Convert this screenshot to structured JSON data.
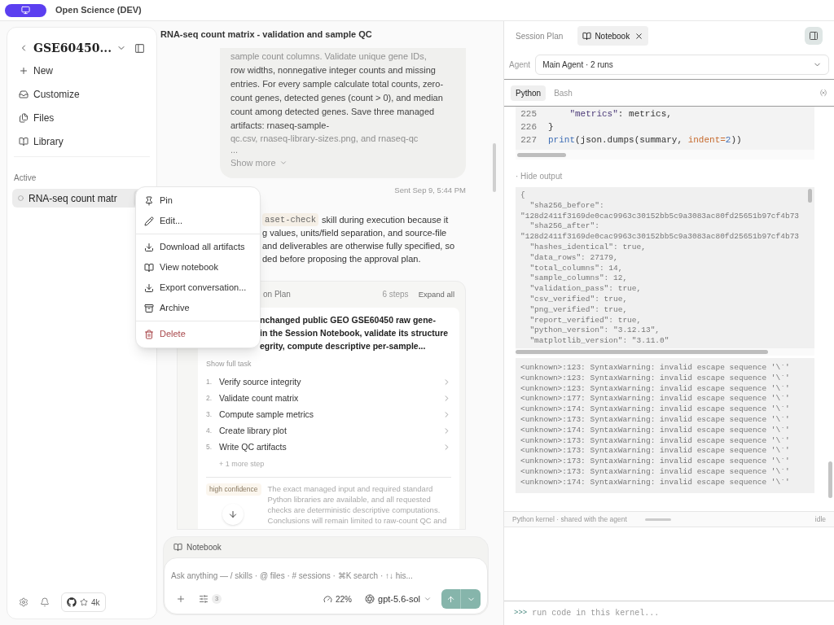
{
  "app": {
    "title": "Open Science (DEV)"
  },
  "sidebar": {
    "project": "GSE60450...",
    "nav": [
      {
        "label": "New"
      },
      {
        "label": "Customize"
      },
      {
        "label": "Files"
      },
      {
        "label": "Library"
      }
    ],
    "section": "Active",
    "sessions": [
      {
        "title": "RNA-seq count matr",
        "selected": true
      }
    ],
    "github_stars": "4k"
  },
  "context_menu": {
    "groups": [
      {
        "items": [
          {
            "label": "Pin",
            "kind": "normal"
          },
          {
            "label": "Edit...",
            "kind": "normal"
          }
        ]
      },
      {
        "items": [
          {
            "label": "Download all artifacts",
            "kind": "normal"
          },
          {
            "label": "View notebook",
            "kind": "normal"
          },
          {
            "label": "Export conversation...",
            "kind": "normal"
          },
          {
            "label": "Archive",
            "kind": "normal"
          }
        ]
      },
      {
        "items": [
          {
            "label": "Delete",
            "kind": "destructive"
          }
        ]
      }
    ]
  },
  "chat": {
    "title": "RNA-seq count matrix - validation and sample QC",
    "user_message": {
      "faded_line": "sample count columns. Validate unique gene IDs,",
      "text": "row widths, nonnegative integer counts and missing entries. For every sample calculate total counts, zero-count genes, detected genes (count > 0), and median count among detected genes. Save three managed artifacts: rnaseq-sample-",
      "cut_line": "qc.csv, rnaseq-library-sizes.png, and rnaseq-qc",
      "ellipsis": "...",
      "show_more": "Show more"
    },
    "sent": "Sent Sep 9, 5:44 PM",
    "agent_message": {
      "code": "aset-check",
      "first_line": "skill during execution because it",
      "lines": [
        "g values, units/field separation, and source-file",
        "and deliverables are otherwise fully specified, so",
        "ded before proposing the approval plan."
      ]
    },
    "plan": {
      "header": "on Plan",
      "steps_count": "6 steps",
      "expand": "Expand all",
      "task_lines": [
        "nchanged public GEO GSE60450 raw gene-",
        "in the Session Notebook, validate its structure",
        "egrity, compute descriptive per-sample..."
      ],
      "show_full": "Show full task",
      "steps": [
        {
          "number": "1.",
          "label": "Verify source integrity"
        },
        {
          "number": "2.",
          "label": "Validate count matrix"
        },
        {
          "number": "3.",
          "label": "Compute sample metrics"
        },
        {
          "number": "4.",
          "label": "Create library plot"
        },
        {
          "number": "5.",
          "label": "Write QC artifacts"
        }
      ],
      "more": "+ 1 more step",
      "confidence": "high confidence",
      "rationale": "The exact managed input and required standard Python libraries are available, and all requested checks are deterministic descriptive computations. Conclusions will remain limited to raw-count QC and"
    },
    "composer": {
      "context": "Notebook",
      "placeholder": "Ask anything — / skills · @ files · # sessions · ⌘K search · ↑↓ his...",
      "tools_count": "3",
      "context_usage": "22%",
      "model": "gpt-5.6-sol"
    }
  },
  "right_panel": {
    "tabs": [
      {
        "label": "Session Plan",
        "selected": false,
        "closable": false
      },
      {
        "label": "Notebook",
        "selected": true,
        "closable": true
      }
    ],
    "agent": {
      "label": "Agent",
      "value": "Main Agent · 2 runs"
    },
    "kernel_tabs": [
      {
        "label": "Python",
        "selected": true
      },
      {
        "label": "Bash",
        "selected": false
      }
    ],
    "code": [
      {
        "number": "225",
        "tokens": [
          {
            "kind": "string",
            "text": "    \"metrics\""
          },
          {
            "kind": "plain",
            "text": ": metrics,"
          }
        ]
      },
      {
        "number": "226",
        "tokens": [
          {
            "kind": "plain",
            "text": "}"
          }
        ]
      },
      {
        "number": "227",
        "tokens": [
          {
            "kind": "builtin",
            "text": "print"
          },
          {
            "kind": "plain",
            "text": "(json.dumps(summary, "
          },
          {
            "kind": "param",
            "text": "indent"
          },
          {
            "kind": "param",
            "text": "="
          },
          {
            "kind": "number",
            "text": "2"
          },
          {
            "kind": "plain",
            "text": "))"
          }
        ]
      }
    ],
    "hide_output": "· Hide output",
    "output": [
      "{",
      "  \"sha256_before\":",
      "\"128d2411f3169de0cac9963c30152bb5c9a3083ac80fd25651b97cf4b73",
      "  \"sha256_after\":",
      "\"128d2411f3169de0cac9963c30152bb5c9a3083ac80fd25651b97cf4b73",
      "  \"hashes_identical\": true,",
      "  \"data_rows\": 27179,",
      "  \"total_columns\": 14,",
      "  \"sample_columns\": 12,",
      "  \"validation_pass\": true,",
      "  \"csv_verified\": true,",
      "  \"png_verified\": true,",
      "  \"report_verified\": true,",
      "  \"python_version\": \"3.12.13\",",
      "  \"matplotlib_version\": \"3.11.0\""
    ],
    "warnings": [
      "<unknown>:123: SyntaxWarning: invalid escape sequence '\\`'",
      "<unknown>:123: SyntaxWarning: invalid escape sequence '\\`'",
      "<unknown>:123: SyntaxWarning: invalid escape sequence '\\`'",
      "<unknown>:177: SyntaxWarning: invalid escape sequence '\\`'",
      "<unknown>:174: SyntaxWarning: invalid escape sequence '\\`'",
      "<unknown>:173: SyntaxWarning: invalid escape sequence '\\`'",
      "<unknown>:174: SyntaxWarning: invalid escape sequence '\\`'",
      "<unknown>:173: SyntaxWarning: invalid escape sequence '\\`'",
      "<unknown>:173: SyntaxWarning: invalid escape sequence '\\`'",
      "<unknown>:173: SyntaxWarning: invalid escape sequence '\\`'",
      "<unknown>:173: SyntaxWarning: invalid escape sequence '\\`'",
      "<unknown>:174: SyntaxWarning: invalid escape sequence '\\`'"
    ],
    "status": {
      "text": "Python kernel · shared with the agent",
      "state": "idle"
    },
    "console": {
      "prompt": ">>>",
      "placeholder": "run code in this kernel..."
    }
  }
}
